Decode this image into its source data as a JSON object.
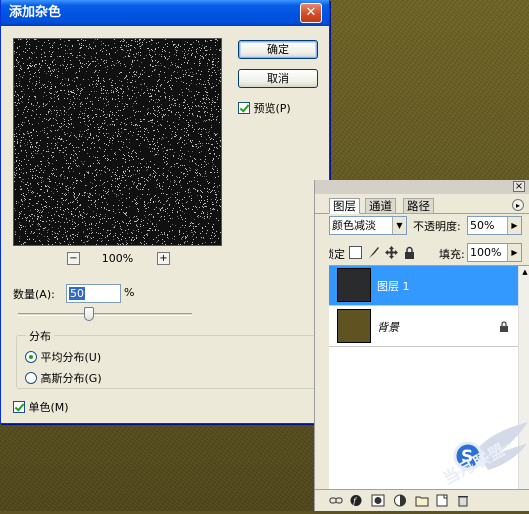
{
  "dialog": {
    "title": "添加杂色",
    "close": "✕",
    "ok_label": "确定",
    "cancel_label": "取消",
    "preview_label": "预览(P)",
    "preview_checked": true,
    "zoom_out": "−",
    "zoom_in": "+",
    "zoom_value": "100%",
    "amount_label": "数量(A):",
    "amount_value": "50",
    "amount_unit": "%",
    "amount_slider_fraction": 0.38,
    "distribution_title": "分布",
    "distribution_options": [
      {
        "label": "平均分布(U)",
        "selected": true
      },
      {
        "label": "高斯分布(G)",
        "selected": false
      }
    ],
    "mono_label": "单色(M)",
    "mono_checked": true
  },
  "layers_panel": {
    "close": "×",
    "tabs": [
      {
        "label": "图层",
        "active": true
      },
      {
        "label": "通道",
        "active": false
      },
      {
        "label": "路径",
        "active": false
      }
    ],
    "menu_arrow": "▸",
    "blend_mode": "颜色减淡",
    "opacity_label": "不透明度:",
    "opacity_value": "50%",
    "lock_label": "锁定:",
    "fill_label": "填充:",
    "fill_value": "100%",
    "layers": [
      {
        "name": "图层 1",
        "selected": true
      },
      {
        "name": "背景",
        "selected": false,
        "locked": true
      }
    ]
  },
  "watermark": {
    "text": "当月联盟",
    "url": "www.5yun.com"
  },
  "colors": {
    "titlebar": "#0054e3",
    "selection": "#3399ff",
    "canvas": "#5d5322",
    "dialog_bg": "#ece9d8"
  }
}
